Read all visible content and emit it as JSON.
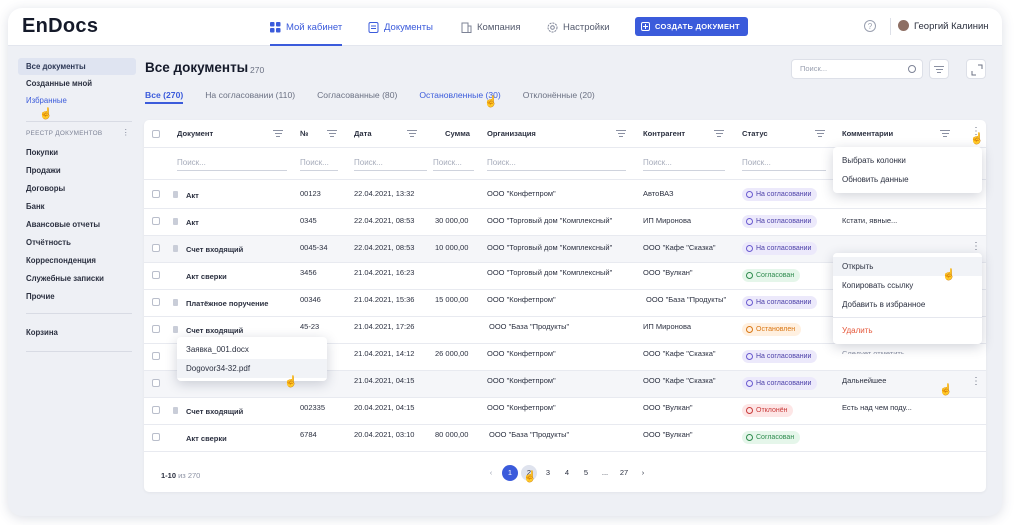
{
  "app": {
    "logo": "EnDocs"
  },
  "nav": {
    "my_cabinet": "Мой кабинет",
    "documents": "Документы",
    "company": "Компания",
    "settings": "Настройки",
    "create_doc": "СОЗДАТЬ ДОКУМЕНТ",
    "help": "?",
    "user_name": "Георгий Калинин"
  },
  "sidebar": {
    "items_top": [
      {
        "label": "Все документы"
      },
      {
        "label": "Созданные мной"
      },
      {
        "label": "Избранные"
      }
    ],
    "registry_header": "РЕЕСТР ДОКУМЕНТОВ",
    "registry_items": [
      {
        "label": "Покупки"
      },
      {
        "label": "Продажи"
      },
      {
        "label": "Договоры"
      },
      {
        "label": "Банк"
      },
      {
        "label": "Авансовые отчеты"
      },
      {
        "label": "Отчётность"
      },
      {
        "label": "Корреспонденция"
      },
      {
        "label": "Служебные записки"
      },
      {
        "label": "Прочие"
      }
    ],
    "trash": "Корзина"
  },
  "main": {
    "title": "Все документы",
    "count": "270",
    "search_placeholder": "Поиск...",
    "tabs": [
      {
        "label": "Все (270)"
      },
      {
        "label": "На согласовании (110)"
      },
      {
        "label": "Согласованные (80)"
      },
      {
        "label": "Остановленные (30)"
      },
      {
        "label": "Отклонённые (20)"
      }
    ]
  },
  "table": {
    "headers": {
      "document": "Документ",
      "number": "№",
      "date": "Дата",
      "sum": "Сумма",
      "org": "Организация",
      "contractor": "Контрагент",
      "status": "Статус",
      "comments": "Комментарии"
    },
    "filter_placeholder": "Поиск...",
    "rows": [
      {
        "doc": "Акт",
        "num": "00123",
        "date": "22.04.2021, 13:32",
        "sum": "",
        "org": "ООО \"Конфетпром\"",
        "contractor": "АвтоВАЗ",
        "status": "На согласовании",
        "comment": ""
      },
      {
        "doc": "Акт",
        "num": "0345",
        "date": "22.04.2021, 08:53",
        "sum": "30 000,00",
        "org": "ООО \"Торговый дом \"Комплексный\"",
        "contractor": "ИП Миронова",
        "status": "На согласовании",
        "comment": "Кстати, явные..."
      },
      {
        "doc": "Счет входящий",
        "num": "0045-34",
        "date": "22.04.2021, 08:53",
        "sum": "10 000,00",
        "org": "ООО \"Торговый дом \"Комплексный\"",
        "contractor": "ООО \"Кафе \"Сказка\"",
        "status": "На согласовании",
        "comment": ""
      },
      {
        "doc": "Акт сверки",
        "num": "3456",
        "date": "21.04.2021, 16:23",
        "sum": "",
        "org": "ООО \"Торговый дом \"Комплексный\"",
        "contractor": "ООО \"Вулкан\"",
        "status": "Согласован",
        "comment": ""
      },
      {
        "doc": "Платёжное поручение",
        "num": "00346",
        "date": "21.04.2021, 15:36",
        "sum": "15 000,00",
        "org": "ООО \"Конфетпром\"",
        "contractor": "ООО \"База \"Продукты\"",
        "status": "На согласовании",
        "comment": ""
      },
      {
        "doc": "Счет входящий",
        "num": "45-23",
        "date": "21.04.2021, 17:26",
        "sum": "",
        "org": "ООО \"База \"Продукты\"",
        "contractor": "ИП Миронова",
        "status": "Остановлен",
        "comment": ""
      },
      {
        "doc": "",
        "num": "",
        "date": "21.04.2021, 14:12",
        "sum": "26 000,00",
        "org": "ООО \"Конфетпром\"",
        "contractor": "ООО \"Кафе \"Сказка\"",
        "status": "На согласовании",
        "comment": ""
      },
      {
        "doc": "",
        "num": "",
        "date": "21.04.2021, 04:15",
        "sum": "",
        "org": "ООО \"Конфетпром\"",
        "contractor": "ООО \"Кафе \"Сказка\"",
        "status": "На согласовании",
        "comment": "Дальнейшее"
      },
      {
        "doc": "Счет входящий",
        "num": "002335",
        "date": "20.04.2021, 04:15",
        "sum": "",
        "org": "ООО \"Конфетпром\"",
        "contractor": "ООО \"Вулкан\"",
        "status": "Отклонён",
        "comment": "Есть над чем поду..."
      },
      {
        "doc": "Акт сверки",
        "num": "6784",
        "date": "20.04.2021, 03:10",
        "sum": "80 000,00",
        "org": "ООО \"База \"Продукты\"",
        "contractor": "ООО \"Вулкан\"",
        "status": "Согласован",
        "comment": ""
      }
    ],
    "comment_partial": "Следует отметить"
  },
  "column_menu": {
    "items": [
      {
        "label": "Выбрать колонки"
      },
      {
        "label": "Обновить  данные"
      }
    ]
  },
  "row_menu": {
    "items": [
      {
        "label": "Открыть"
      },
      {
        "label": "Копировать ссылку"
      },
      {
        "label": "Добавить в избранное"
      }
    ],
    "delete": "Удалить"
  },
  "file_popup": {
    "items": [
      {
        "label": "Заявка_001.docx"
      },
      {
        "label": "Dogovor34-32.pdf"
      }
    ]
  },
  "pagination": {
    "range": "1-10",
    "of": "из 270",
    "prev": "‹",
    "next": "›",
    "pages": [
      "1",
      "2",
      "3",
      "4",
      "5",
      "...",
      "27"
    ]
  },
  "colors": {
    "accent": "#3b5bdb",
    "danger": "#e5573a"
  }
}
